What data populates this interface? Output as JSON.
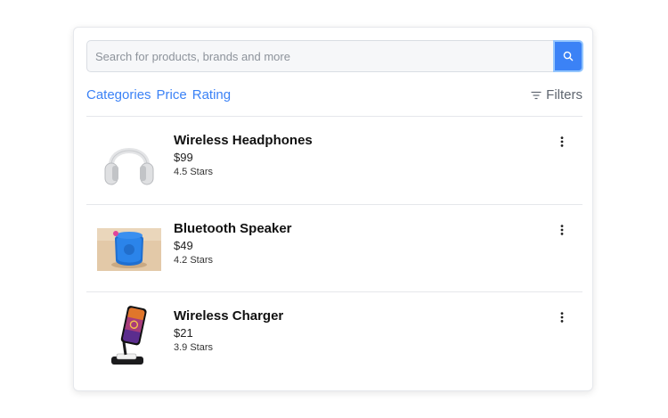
{
  "search": {
    "placeholder": "Search for products, brands and more",
    "value": ""
  },
  "nav": {
    "links": [
      "Categories",
      "Price",
      "Rating"
    ],
    "filters_label": "Filters"
  },
  "products": [
    {
      "name": "Wireless Headphones",
      "price": "$99",
      "rating": "4.5 Stars",
      "image": "headphones-image"
    },
    {
      "name": "Bluetooth Speaker",
      "price": "$49",
      "rating": "4.2 Stars",
      "image": "speaker-image"
    },
    {
      "name": "Wireless Charger",
      "price": "$21",
      "rating": "3.9 Stars",
      "image": "charger-image"
    }
  ],
  "colors": {
    "accent": "#3b82f6",
    "divider": "#e5e7eb"
  },
  "icons": {
    "search": "search-icon",
    "filter": "filter-icon",
    "more": "more-vertical-icon"
  }
}
